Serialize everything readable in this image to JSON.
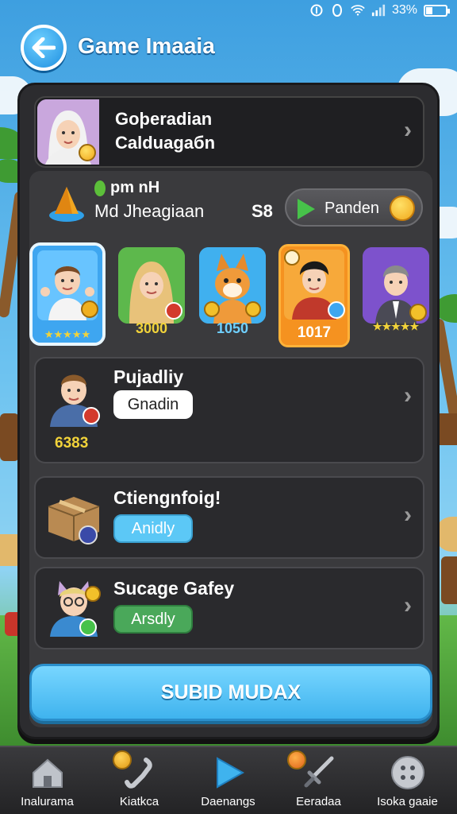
{
  "status_bar": {
    "battery": "33%",
    "battery_level": 0.33
  },
  "header": {
    "title": "Game Imaaia"
  },
  "profile": {
    "name": "Goþeradian",
    "subtitle": "Calduagaбn"
  },
  "info": {
    "top_label": "pm nH",
    "name": "Md Jheagiaan",
    "score": "S8",
    "play_label": "Panden"
  },
  "avatars": [
    {
      "label": "★★★★★",
      "color": "#f2d33a",
      "kind": "boy"
    },
    {
      "label": "3000",
      "color": "#f2d33a",
      "kind": "girl"
    },
    {
      "label": "1050",
      "color": "#6fd0ff",
      "kind": "fox"
    },
    {
      "label": "1017",
      "color": "#ffffff",
      "kind": "man"
    },
    {
      "label": "★★★★★",
      "color": "#f2d33a",
      "kind": "suit"
    }
  ],
  "rows": [
    {
      "title": "Pujadliy",
      "button": "Gnadin",
      "count": "6383"
    },
    {
      "title": "Ctiengnfoig!",
      "button": "Anidly"
    },
    {
      "title": "Sucage Gafey",
      "button": "Arsdly"
    }
  ],
  "cta": {
    "label": "SUBID MUDAX"
  },
  "bottom_nav": [
    {
      "label": "Inalurama",
      "icon": "home-icon"
    },
    {
      "label": "Kiatkca",
      "icon": "phone-icon"
    },
    {
      "label": "Daenangs",
      "icon": "play-icon"
    },
    {
      "label": "Eeradaa",
      "icon": "sword-icon"
    },
    {
      "label": "Isoka gaaie",
      "icon": "more-icon"
    }
  ],
  "colors": {
    "accent": "#3fb3ee",
    "panel": "#2c2c2f",
    "green": "#47c24a"
  }
}
